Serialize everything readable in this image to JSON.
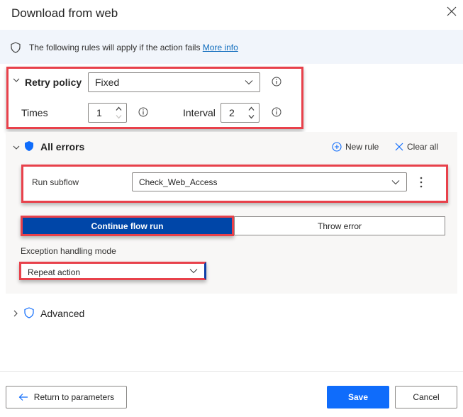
{
  "dialog": {
    "title": "Download from web",
    "close_icon": "close-icon"
  },
  "banner": {
    "icon": "shield-outline-icon",
    "text": "The following rules will apply if the action fails ",
    "link": "More info"
  },
  "retry_policy": {
    "label": "Retry policy",
    "expanded": true,
    "selected": "Fixed",
    "times_label": "Times",
    "times_value": "1",
    "interval_label": "Interval",
    "interval_value": "2"
  },
  "all_errors": {
    "label": "All errors",
    "expanded": true,
    "new_rule": "New rule",
    "clear_all": "Clear all",
    "run_subflow_label": "Run subflow",
    "run_subflow_value": "Check_Web_Access",
    "segments": [
      "Continue flow run",
      "Throw error"
    ],
    "selected_segment": "Continue flow run",
    "mode_label": "Exception handling mode",
    "mode_value": "Repeat action"
  },
  "advanced": {
    "label": "Advanced",
    "expanded": false
  },
  "footer": {
    "return_label": "Return to parameters",
    "save_label": "Save",
    "cancel_label": "Cancel"
  },
  "colors": {
    "accent": "#0f6cfb",
    "selected_segment": "#0046a8",
    "highlight": "#e8414b",
    "link": "#0f6cbd"
  }
}
